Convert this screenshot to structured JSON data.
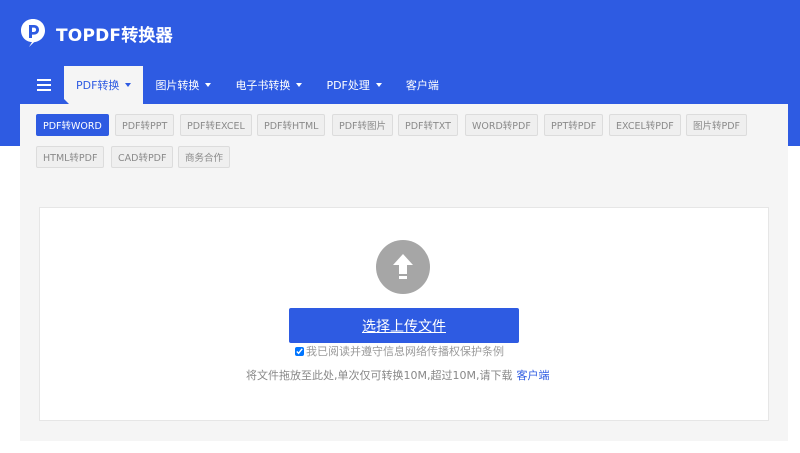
{
  "brand": {
    "name": "TOPDF转换器",
    "color": "#2e5be2"
  },
  "nav": {
    "menu_icon": "hamburger-icon",
    "items": [
      {
        "label": "PDF转换",
        "dropdown": true,
        "active": true
      },
      {
        "label": "图片转换",
        "dropdown": true,
        "active": false
      },
      {
        "label": "电子书转换",
        "dropdown": true,
        "active": false
      },
      {
        "label": "PDF处理",
        "dropdown": true,
        "active": false
      },
      {
        "label": "客户端",
        "dropdown": false,
        "active": false
      }
    ]
  },
  "subnav": {
    "items": [
      {
        "label": "PDF转WORD",
        "active": true
      },
      {
        "label": "PDF转PPT",
        "active": false
      },
      {
        "label": "PDF转EXCEL",
        "active": false
      },
      {
        "label": "PDF转HTML",
        "active": false
      },
      {
        "label": "PDF转图片",
        "active": false
      },
      {
        "label": "PDF转TXT",
        "active": false
      },
      {
        "label": "WORD转PDF",
        "active": false
      },
      {
        "label": "PPT转PDF",
        "active": false
      },
      {
        "label": "EXCEL转PDF",
        "active": false
      },
      {
        "label": "图片转PDF",
        "active": false
      },
      {
        "label": "HTML转PDF",
        "active": false
      },
      {
        "label": "CAD转PDF",
        "active": false
      },
      {
        "label": "商务合作",
        "active": false
      }
    ]
  },
  "upload": {
    "icon": "upload-arrow-icon",
    "button_label": "选择上传文件",
    "agreement": {
      "checked": true,
      "text": "我已阅读并遵守信息网络传播权保护条例"
    },
    "hint": "将文件拖放至此处,单次仅可转换10M,超过10M,请下载",
    "hint_link": "客户端"
  }
}
